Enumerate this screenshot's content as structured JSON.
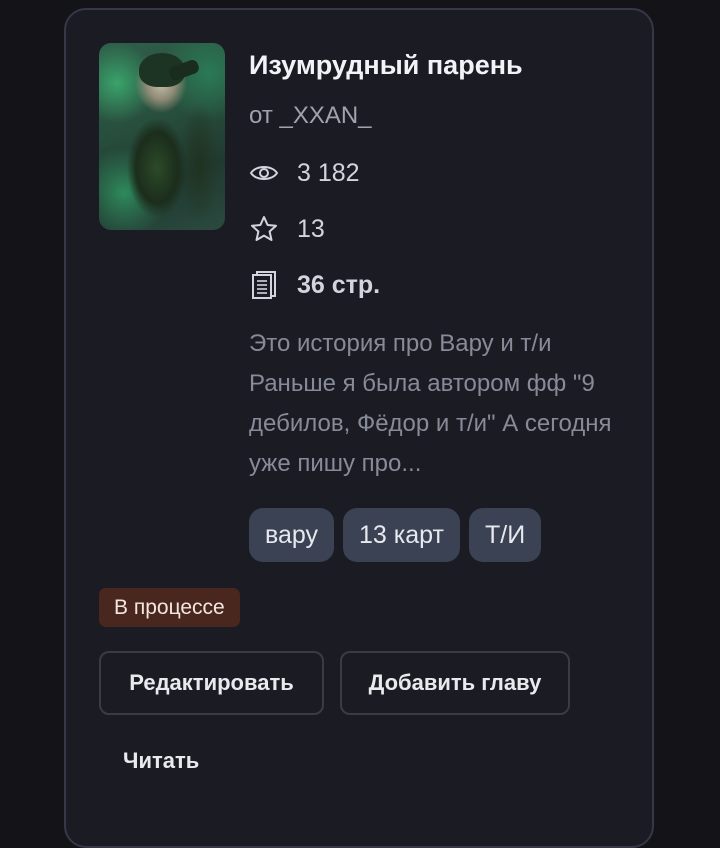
{
  "book": {
    "title": "Изумрудный парень",
    "author": "от _XXAN_",
    "views": "3 182",
    "likes": "13",
    "pages": "36 стр.",
    "description": "Это история про Вару и т/и Раньше я была автором фф \"9 дебилов, Фёдор и т/и\" А сегодня уже пишу про...",
    "tags": [
      "вару",
      "13 карт",
      "Т/И"
    ],
    "status": "В процессе"
  },
  "actions": {
    "edit_label": "Редактировать",
    "add_chapter_label": "Добавить главу",
    "read_label": "Читать"
  },
  "icons": {
    "views": "eye-icon",
    "likes": "star-icon",
    "pages": "document-pages-icon"
  },
  "colors": {
    "card_bg": "#1b1b23",
    "card_border": "#343847",
    "tag_bg": "#3a4253",
    "status_bg": "#4a271e"
  }
}
